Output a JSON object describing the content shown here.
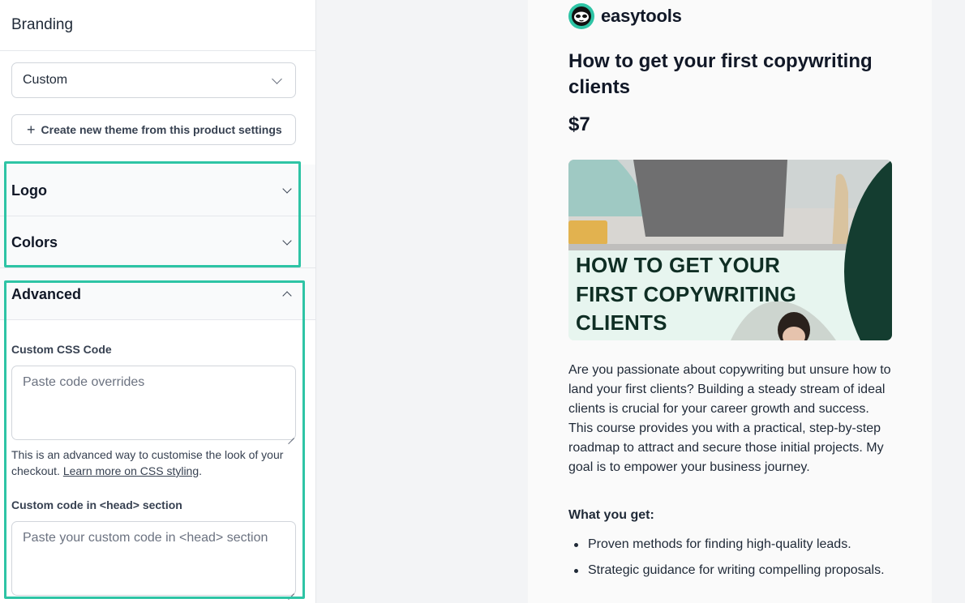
{
  "panel": {
    "title": "Branding",
    "theme_select": {
      "value": "Custom"
    },
    "create_button": {
      "label": "Create new theme from this product settings"
    },
    "sections": {
      "logo": "Logo",
      "colors": "Colors",
      "advanced": "Advanced"
    },
    "css": {
      "label": "Custom CSS Code",
      "placeholder": "Paste code overrides",
      "help_text": "This is an advanced way to customise the look of your checkout. ",
      "help_link": "Learn more on CSS styling",
      "help_suffix": "."
    },
    "head": {
      "label": "Custom code in <head> section",
      "placeholder": "Paste your custom code in <head> section"
    },
    "highlight_color": "#2ec4a5"
  },
  "preview": {
    "brand_name": "easytools",
    "product_title": "How to get your first copywriting clients",
    "price": "$7",
    "hero": {
      "line1": "HOW TO GET YOUR",
      "line2": "FIRST COPYWRITING",
      "line3": "CLIENTS"
    },
    "description": "Are you passionate about copywriting but unsure how to land your first clients? Building a steady stream of ideal clients is crucial for your career growth and success. This course provides you with a practical, step-by-step roadmap to attract and secure those initial projects. My goal is to empower your business journey.",
    "what_you_get": "What you get:",
    "benefits": [
      "Proven methods for finding high-quality leads.",
      "Strategic guidance for writing compelling proposals."
    ]
  }
}
